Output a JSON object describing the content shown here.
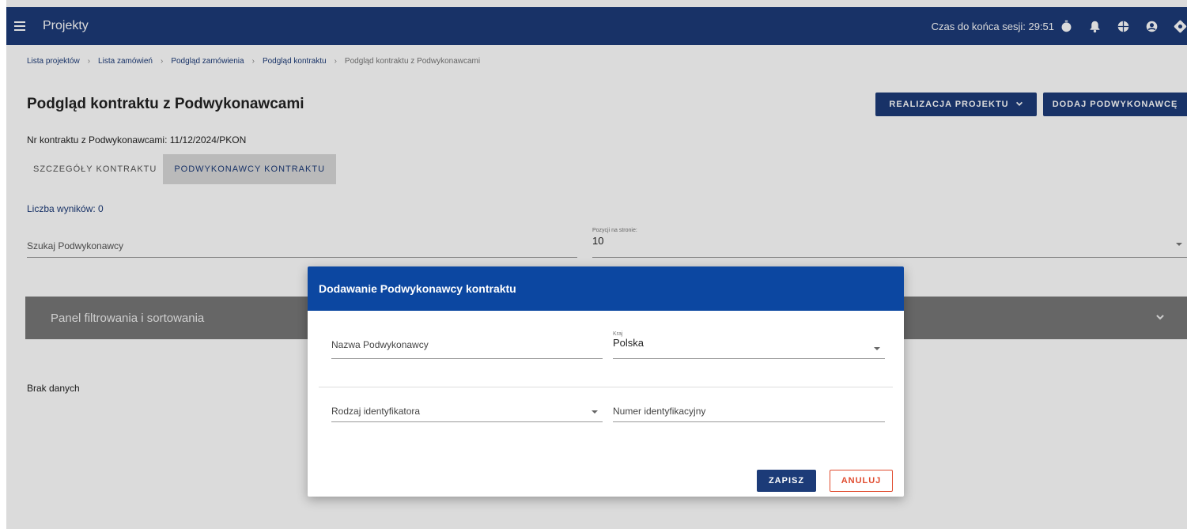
{
  "app": {
    "title": "Projekty",
    "session_label": "Czas do końca sesji: 29:51",
    "icons": [
      "menu-icon",
      "stopwatch-icon",
      "notification-bell-icon",
      "globe-icon",
      "account-icon",
      "settings-icon"
    ]
  },
  "breadcrumb": [
    "Lista projektów",
    "Lista zamówień",
    "Podgląd zamówienia",
    "Podgląd kontraktu",
    "Podgląd kontraktu z Podwykonawcami"
  ],
  "page": {
    "title": "Podgląd kontraktu z Podwykonawcami",
    "realizacja_button": "REALIZACJA PROJEKTU",
    "dodaj_button": "DODAJ PODWYKONAWCĘ",
    "contract_nr": "Nr kontraktu z Podwykonawcami: 11/12/2024/PKON",
    "tabs": [
      {
        "label": "SZCZEGÓŁY KONTRAKTU",
        "active": false
      },
      {
        "label": "PODWYKONAWCY KONTRAKTU",
        "active": true
      }
    ],
    "results_count": "Liczba wyników: 0",
    "search_placeholder": "Szukaj Podwykonawcy",
    "per_page_label": "Pozycji na stronie:",
    "per_page_value": "10",
    "filter_panel_label": "Panel filtrowania i sortowania",
    "no_data": "Brak danych"
  },
  "dialog": {
    "title": "Dodawanie Podwykonawcy kontraktu",
    "name_placeholder": "Nazwa Podwykonawcy",
    "country_label": "Kraj",
    "country_value": "Polska",
    "id_type_placeholder": "Rodzaj identyfikatora",
    "id_number_placeholder": "Numer identyfikacyjny",
    "save_label": "ZAPISZ",
    "cancel_label": "ANULUJ"
  },
  "colors": {
    "topbar": "#1c3b78",
    "dialog_header": "#0c47a1",
    "filter_panel": "#777777",
    "cancel_accent": "#e04b2e"
  }
}
